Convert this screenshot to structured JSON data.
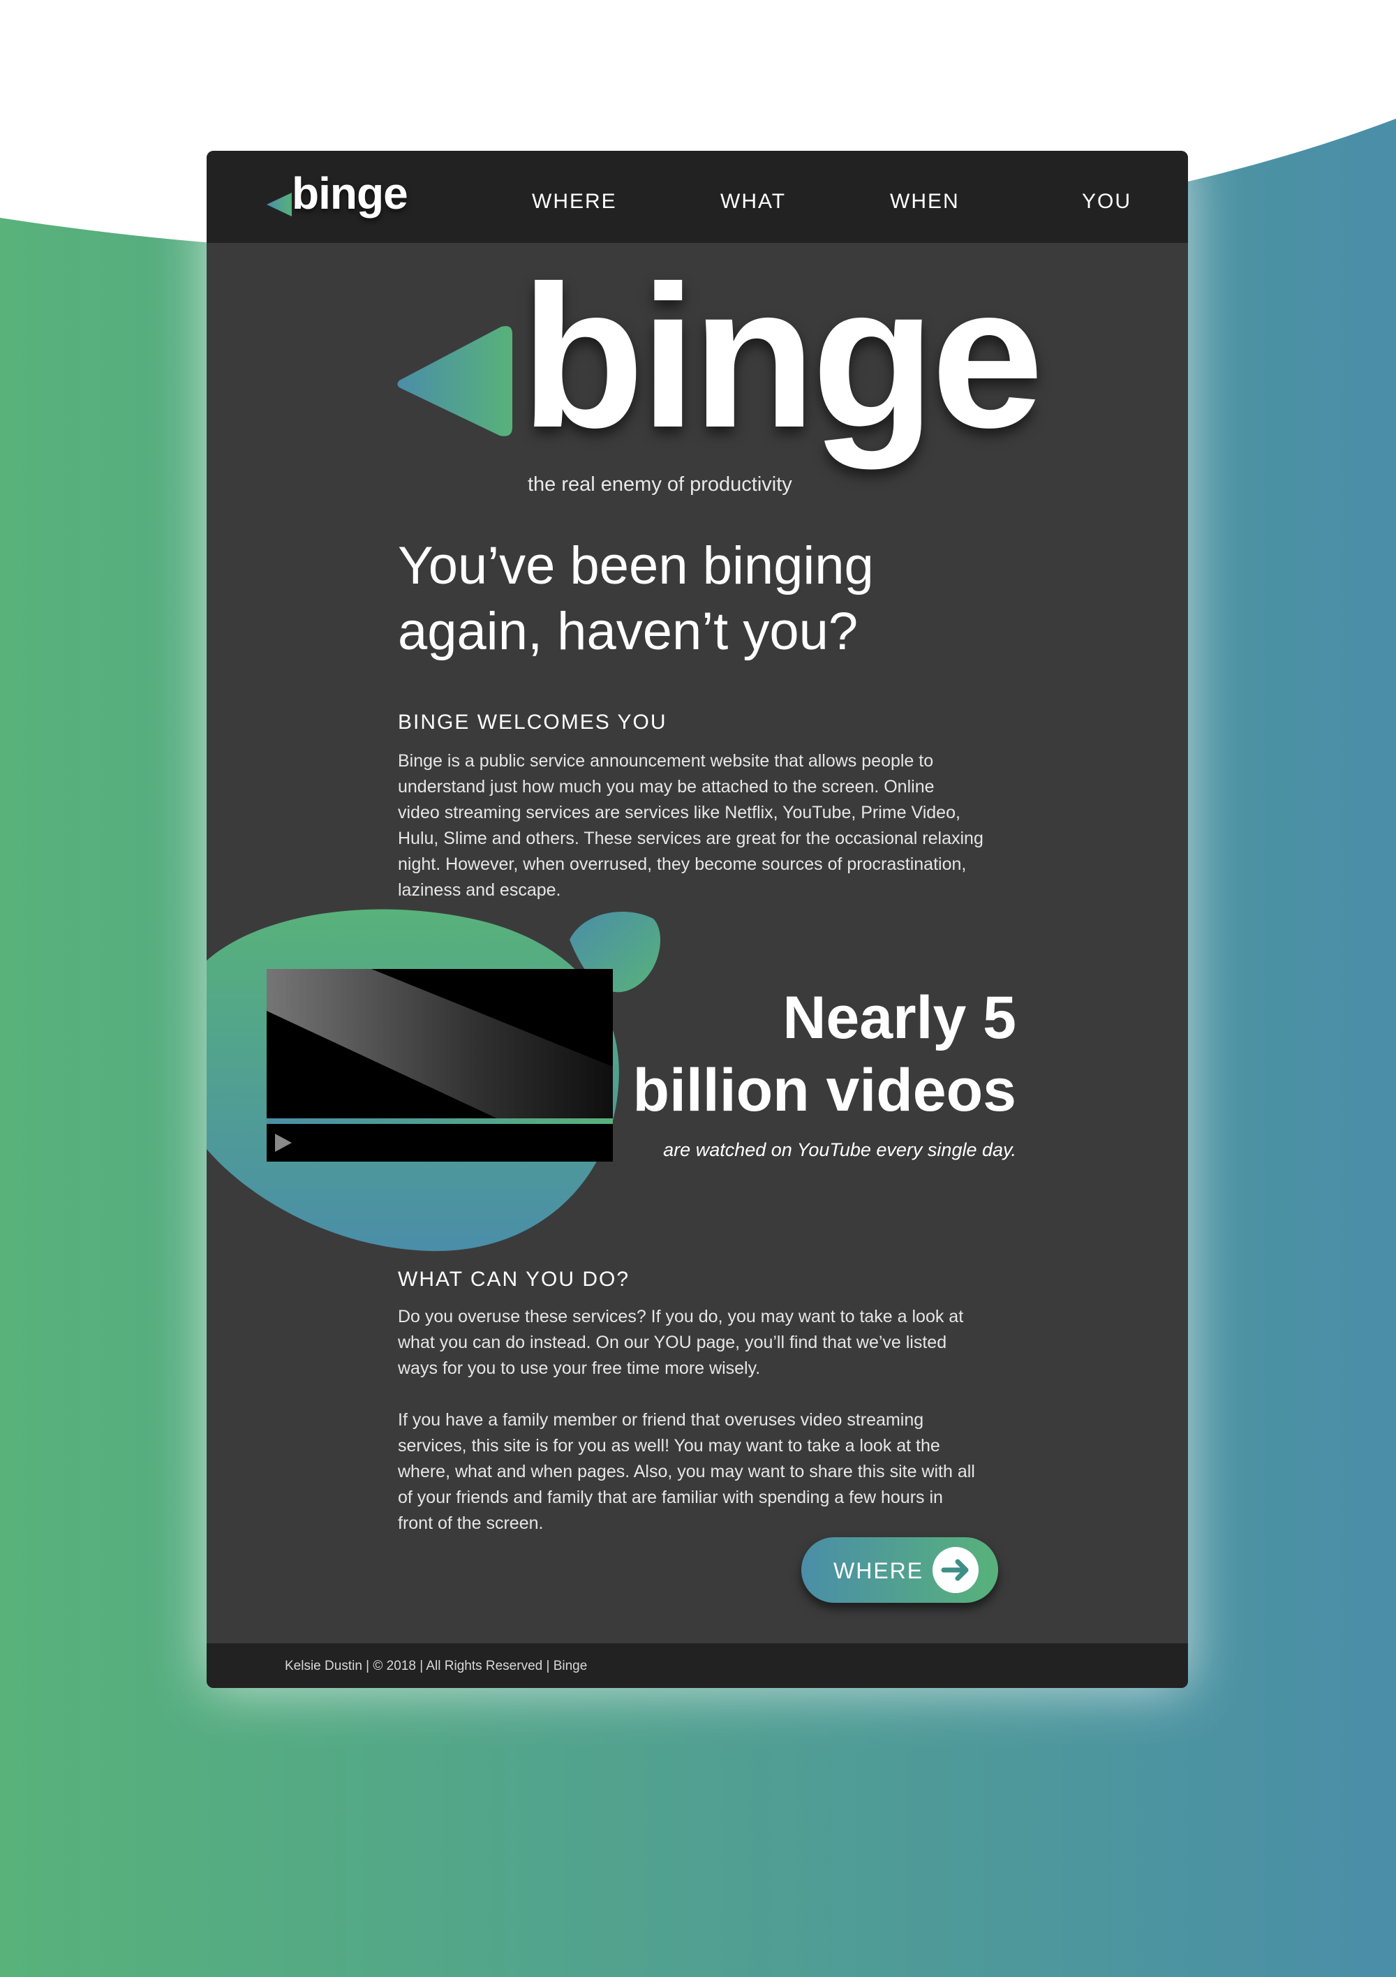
{
  "nav": {
    "logo_text": "binge",
    "links": [
      "WHERE",
      "WHAT",
      "WHEN",
      "YOU"
    ]
  },
  "hero": {
    "logo_text": "binge",
    "tagline": "the real enemy of productivity",
    "headline_line1": "You’ve been binging",
    "headline_line2": "again, haven’t you?"
  },
  "welcome": {
    "title": "BINGE WELCOMES YOU",
    "lines": [
      "Binge is a public service announcement website that allows people to",
      "understand just how much you may be attached to the screen. Online",
      "video streaming services are services like Netflix, YouTube, Prime Video,",
      "Hulu, Slime and others. These services are great for the occasional relaxing",
      "night. However, when overrused, they become sources of procrastination,",
      "laziness and escape."
    ]
  },
  "stat": {
    "line1": "Nearly 5",
    "line2": "billion videos",
    "caption": "are watched on YouTube every single day."
  },
  "what_can": {
    "title": "WHAT CAN YOU DO?",
    "para1_lines": [
      "Do you overuse these services? If you do, you may want to take a look at",
      "what you can do instead. On our YOU page, you’ll find that we’ve listed",
      "ways for you to use your free time more wisely."
    ],
    "para2_lines": [
      "If you have a family member or friend that overuses video streaming",
      "services, this site is for you as well! You may want to take a look at the",
      "where, what and when pages. Also, you may want to share this site with all",
      "of your friends and family that are familiar with spending a few hours in",
      "front of the screen."
    ]
  },
  "cta": {
    "label": "WHERE",
    "icon": "arrow-right-icon"
  },
  "footer": {
    "text": "Kelsie Dustin | © 2018 | All Rights Reserved | Binge"
  },
  "colors": {
    "green": "#58b27a",
    "blue": "#4a8ea8",
    "panel": "#3b3b3c",
    "header": "#232223"
  }
}
